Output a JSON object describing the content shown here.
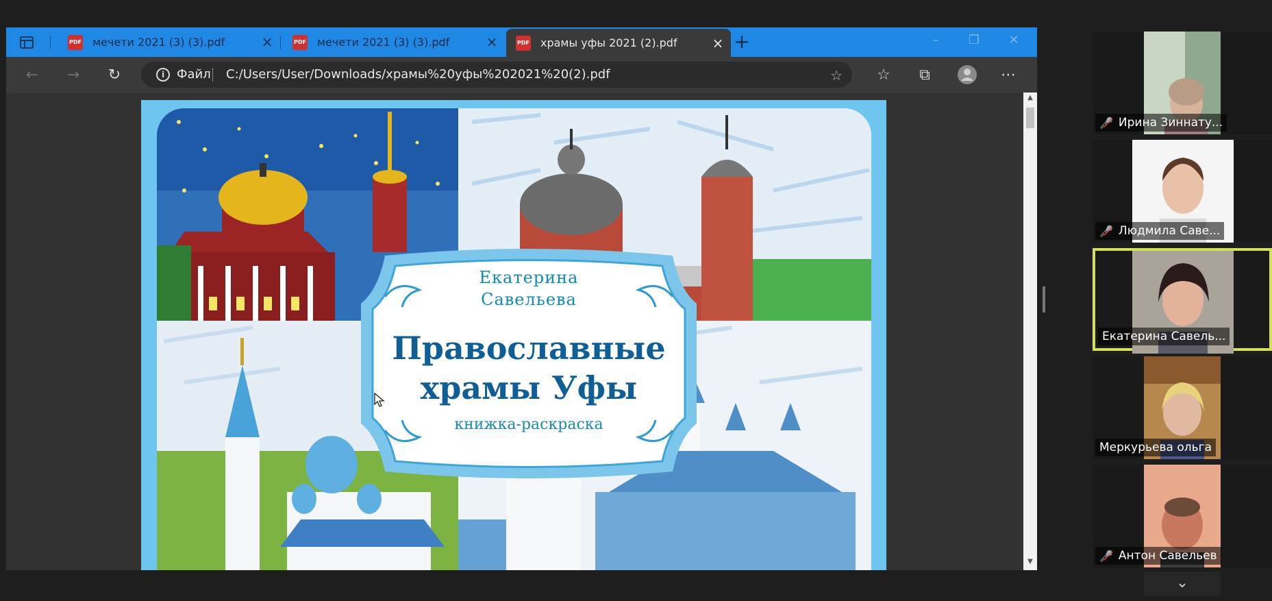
{
  "browser": {
    "tabs": [
      {
        "label": "мечети 2021 (3) (3).pdf",
        "icon": "pdf-icon",
        "active": false
      },
      {
        "label": "мечети 2021 (3) (3).pdf",
        "icon": "pdf-icon",
        "active": false
      },
      {
        "label": "храмы уфы 2021 (2).pdf",
        "icon": "pdf-icon",
        "active": true
      }
    ],
    "address": {
      "scheme_label": "Файл",
      "url": "C:/Users/User/Downloads/храмы%20уфы%202021%20(2).pdf"
    }
  },
  "document": {
    "author_line1": "Екатерина",
    "author_line2": "Савельева",
    "title_line1": "Православные",
    "title_line2": "храмы Уфы",
    "subtitle": "книжка-раскраска"
  },
  "participants": [
    {
      "name": "Ирина Зиннату...",
      "muted": true,
      "speaking": false
    },
    {
      "name": "Людмила Саве...",
      "muted": true,
      "speaking": false
    },
    {
      "name": "Екатерина Савель...",
      "muted": false,
      "speaking": true
    },
    {
      "name": "Меркурьева ольга",
      "muted": false,
      "speaking": false
    },
    {
      "name": "Антон Савельев",
      "muted": true,
      "speaking": false
    }
  ],
  "colors": {
    "tabbar": "#1f88e5",
    "speaking_border": "#d4e157",
    "mic_muted": "#e53935",
    "page_frame": "#6ec6f0"
  }
}
